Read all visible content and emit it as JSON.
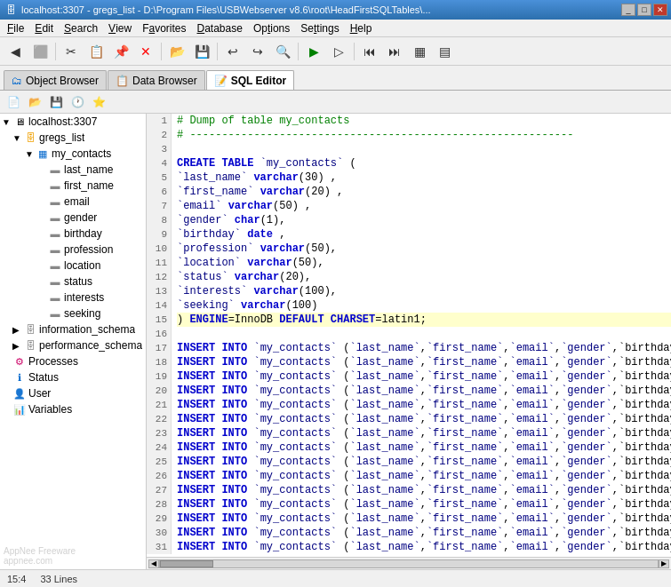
{
  "titlebar": {
    "title": "localhost:3307 - gregs_list - D:\\Program Files\\USBWebserver v8.6\\root\\HeadFirstSQLTables\\...",
    "icon": "🗄"
  },
  "menubar": {
    "items": [
      {
        "label": "File",
        "underline": "F"
      },
      {
        "label": "Edit",
        "underline": "E"
      },
      {
        "label": "Search",
        "underline": "S"
      },
      {
        "label": "View",
        "underline": "V"
      },
      {
        "label": "Favorites",
        "underline": "a"
      },
      {
        "label": "Database",
        "underline": "D"
      },
      {
        "label": "Options",
        "underline": "O"
      },
      {
        "label": "Settings",
        "underline": "t"
      },
      {
        "label": "Help",
        "underline": "H"
      }
    ]
  },
  "tabbar": {
    "tabs": [
      {
        "label": "Object Browser",
        "active": false,
        "icon": "🗂"
      },
      {
        "label": "Data Browser",
        "active": false,
        "icon": "📋"
      },
      {
        "label": "SQL Editor",
        "active": true,
        "icon": "📝"
      }
    ]
  },
  "sidebar": {
    "items": [
      {
        "level": 0,
        "label": "localhost:3307",
        "icon": "server",
        "toggle": "▼",
        "type": "server"
      },
      {
        "level": 1,
        "label": "gregs_list",
        "icon": "db",
        "toggle": "▼",
        "type": "db"
      },
      {
        "level": 2,
        "label": "my_contacts",
        "icon": "table",
        "toggle": "▼",
        "type": "table"
      },
      {
        "level": 3,
        "label": "last_name",
        "icon": "col",
        "toggle": "",
        "type": "column"
      },
      {
        "level": 3,
        "label": "first_name",
        "icon": "col",
        "toggle": "",
        "type": "column"
      },
      {
        "level": 3,
        "label": "email",
        "icon": "col",
        "toggle": "",
        "type": "column"
      },
      {
        "level": 3,
        "label": "gender",
        "icon": "col",
        "toggle": "",
        "type": "column"
      },
      {
        "level": 3,
        "label": "birthday",
        "icon": "col",
        "toggle": "",
        "type": "column"
      },
      {
        "level": 3,
        "label": "profession",
        "icon": "col",
        "toggle": "",
        "type": "column"
      },
      {
        "level": 3,
        "label": "location",
        "icon": "col",
        "toggle": "",
        "type": "column"
      },
      {
        "level": 3,
        "label": "status",
        "icon": "col",
        "toggle": "",
        "type": "column"
      },
      {
        "level": 3,
        "label": "interests",
        "icon": "col",
        "toggle": "",
        "type": "column"
      },
      {
        "level": 3,
        "label": "seeking",
        "icon": "col",
        "toggle": "",
        "type": "column"
      },
      {
        "level": 1,
        "label": "information_schema",
        "icon": "schema",
        "toggle": "▶",
        "type": "schema"
      },
      {
        "level": 1,
        "label": "performance_schema",
        "icon": "schema",
        "toggle": "▶",
        "type": "schema"
      },
      {
        "level": 0,
        "label": "Processes",
        "icon": "process",
        "toggle": "",
        "type": "processes"
      },
      {
        "level": 0,
        "label": "Status",
        "icon": "status",
        "toggle": "",
        "type": "status"
      },
      {
        "level": 0,
        "label": "User",
        "icon": "user",
        "toggle": "",
        "type": "user"
      },
      {
        "level": 0,
        "label": "Variables",
        "icon": "var",
        "toggle": "",
        "type": "variables"
      }
    ]
  },
  "editor": {
    "lines": [
      {
        "num": 1,
        "text": "# Dump of table my_contacts",
        "type": "comment",
        "highlight": false
      },
      {
        "num": 2,
        "text": "# ------------------------------------------------------------",
        "type": "comment",
        "highlight": false
      },
      {
        "num": 3,
        "text": "",
        "type": "normal",
        "highlight": false
      },
      {
        "num": 4,
        "text": "CREATE TABLE `my_contacts` (",
        "type": "code",
        "highlight": false
      },
      {
        "num": 5,
        "text": "  `last_name` varchar(30) ,",
        "type": "code",
        "highlight": false
      },
      {
        "num": 6,
        "text": "  `first_name` varchar(20) ,",
        "type": "code",
        "highlight": false
      },
      {
        "num": 7,
        "text": "  `email` varchar(50) ,",
        "type": "code",
        "highlight": false
      },
      {
        "num": 8,
        "text": "  `gender` char(1),",
        "type": "code",
        "highlight": false
      },
      {
        "num": 9,
        "text": "  `birthday` date ,",
        "type": "code",
        "highlight": false
      },
      {
        "num": 10,
        "text": "  `profession` varchar(50),",
        "type": "code",
        "highlight": false
      },
      {
        "num": 11,
        "text": "  `location` varchar(50),",
        "type": "code",
        "highlight": false
      },
      {
        "num": 12,
        "text": "  `status` varchar(20),",
        "type": "code",
        "highlight": false
      },
      {
        "num": 13,
        "text": "  `interests` varchar(100),",
        "type": "code",
        "highlight": false
      },
      {
        "num": 14,
        "text": "  `seeking` varchar(100)",
        "type": "code",
        "highlight": false
      },
      {
        "num": 15,
        "text": ") ENGINE=InnoDB DEFAULT CHARSET=latin1;",
        "type": "code",
        "highlight": true
      },
      {
        "num": 16,
        "text": "",
        "type": "normal",
        "highlight": false
      },
      {
        "num": 17,
        "text": "INSERT INTO `my_contacts` (`last_name`,`first_name`,`email`,`gender`,`birthday",
        "type": "code",
        "highlight": false
      },
      {
        "num": 18,
        "text": "INSERT INTO `my_contacts` (`last_name`,`first_name`,`email`,`gender`,`birthday",
        "type": "code",
        "highlight": false
      },
      {
        "num": 19,
        "text": "INSERT INTO `my_contacts` (`last_name`,`first_name`,`email`,`gender`,`birthday",
        "type": "code",
        "highlight": false
      },
      {
        "num": 20,
        "text": "INSERT INTO `my_contacts` (`last_name`,`first_name`,`email`,`gender`,`birthday",
        "type": "code",
        "highlight": false
      },
      {
        "num": 21,
        "text": "INSERT INTO `my_contacts` (`last_name`,`first_name`,`email`,`gender`,`birthday",
        "type": "code",
        "highlight": false
      },
      {
        "num": 22,
        "text": "INSERT INTO `my_contacts` (`last_name`,`first_name`,`email`,`gender`,`birthday",
        "type": "code",
        "highlight": false
      },
      {
        "num": 23,
        "text": "INSERT INTO `my_contacts` (`last_name`,`first_name`,`email`,`gender`,`birthday",
        "type": "code",
        "highlight": false
      },
      {
        "num": 24,
        "text": "INSERT INTO `my_contacts` (`last_name`,`first_name`,`email`,`gender`,`birthday",
        "type": "code",
        "highlight": false
      },
      {
        "num": 25,
        "text": "INSERT INTO `my_contacts` (`last_name`,`first_name`,`email`,`gender`,`birthday",
        "type": "code",
        "highlight": false
      },
      {
        "num": 26,
        "text": "INSERT INTO `my_contacts` (`last_name`,`first_name`,`email`,`gender`,`birthday",
        "type": "code",
        "highlight": false
      },
      {
        "num": 27,
        "text": "INSERT INTO `my_contacts` (`last_name`,`first_name`,`email`,`gender`,`birthday",
        "type": "code",
        "highlight": false
      },
      {
        "num": 28,
        "text": "INSERT INTO `my_contacts` (`last_name`,`first_name`,`email`,`gender`,`birthday",
        "type": "code",
        "highlight": false
      },
      {
        "num": 29,
        "text": "INSERT INTO `my_contacts` (`last_name`,`first_name`,`email`,`gender`,`birthday",
        "type": "code",
        "highlight": false
      },
      {
        "num": 30,
        "text": "INSERT INTO `my_contacts` (`last_name`,`first_name`,`email`,`gender`,`birthday",
        "type": "code",
        "highlight": false
      },
      {
        "num": 31,
        "text": "INSERT INTO `my_contacts` (`last_name`,`first_name`,`email`,`gender`,`birthday",
        "type": "code",
        "highlight": false
      }
    ]
  },
  "statusbar": {
    "position": "15:4",
    "lines": "33 Lines"
  },
  "watermark": "AppNee Freeware\nappnee.com"
}
